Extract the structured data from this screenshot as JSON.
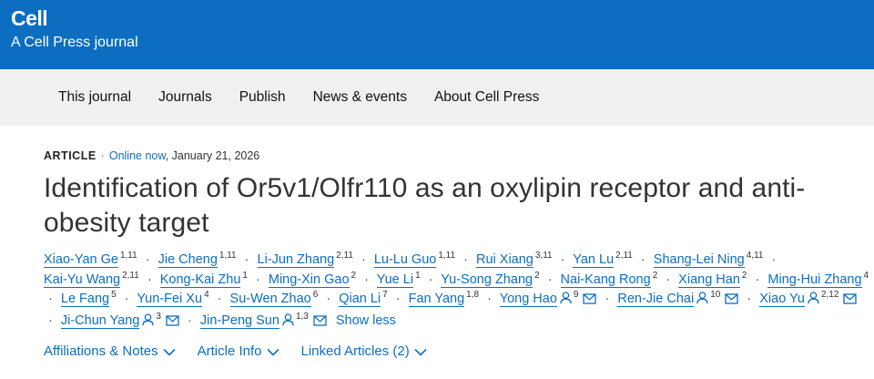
{
  "brand": {
    "logo": "Cell",
    "tagline": "A Cell Press journal"
  },
  "nav": {
    "items": [
      "This journal",
      "Journals",
      "Publish",
      "News & events",
      "About Cell Press"
    ]
  },
  "article": {
    "type": "ARTICLE",
    "separator": "·",
    "status": "Online now",
    "date": ", January 21, 2026",
    "title": "Identification of Or5v1/Olfr110 as an oxylipin receptor and anti-obesity target"
  },
  "authors": [
    {
      "name": "Xiao-Yan Ge",
      "aff": "1,11"
    },
    {
      "name": "Jie Cheng",
      "aff": "1,11"
    },
    {
      "name": "Li-Jun Zhang",
      "aff": "2,11"
    },
    {
      "name": "Lu-Lu Guo",
      "aff": "1,11"
    },
    {
      "name": "Rui Xiang",
      "aff": "3,11"
    },
    {
      "name": "Yan Lu",
      "aff": "2,11"
    },
    {
      "name": "Shang-Lei Ning",
      "aff": "4,11"
    },
    {
      "name": "Kai-Yu Wang",
      "aff": "2,11"
    },
    {
      "name": "Kong-Kai Zhu",
      "aff": "1"
    },
    {
      "name": "Ming-Xin Gao",
      "aff": "2"
    },
    {
      "name": "Yue Li",
      "aff": "1"
    },
    {
      "name": "Yu-Song Zhang",
      "aff": "2"
    },
    {
      "name": "Nai-Kang Rong",
      "aff": "2"
    },
    {
      "name": "Xiang Han",
      "aff": "2"
    },
    {
      "name": "Ming-Hui Zhang",
      "aff": "4"
    },
    {
      "name": "Le Fang",
      "aff": "5"
    },
    {
      "name": "Yun-Fei Xu",
      "aff": "4"
    },
    {
      "name": "Su-Wen Zhao",
      "aff": "6"
    },
    {
      "name": "Qian Li",
      "aff": "7"
    },
    {
      "name": "Fan Yang",
      "aff": "1,8"
    },
    {
      "name": "Yong Hao",
      "aff": "9",
      "corresponding": true
    },
    {
      "name": "Ren-Jie Chai",
      "aff": "10",
      "corresponding": true
    },
    {
      "name": "Xiao Yu",
      "aff": "2,12",
      "corresponding": true
    },
    {
      "name": "Ji-Chun Yang",
      "aff": "3",
      "corresponding": true
    },
    {
      "name": "Jin-Peng Sun",
      "aff": "1,3",
      "corresponding": true
    }
  ],
  "author_separator": "·",
  "show_less": "Show less",
  "tabs": [
    "Affiliations & Notes",
    "Article Info",
    "Linked Articles (2)"
  ],
  "icons": {
    "corresponding": "person-icon",
    "email": "envelope-icon",
    "expand": "chevron-down-icon"
  },
  "colors": {
    "brand_blue": "#0d6ec1",
    "nav_bg": "#f0f0f0",
    "text": "#222222"
  }
}
